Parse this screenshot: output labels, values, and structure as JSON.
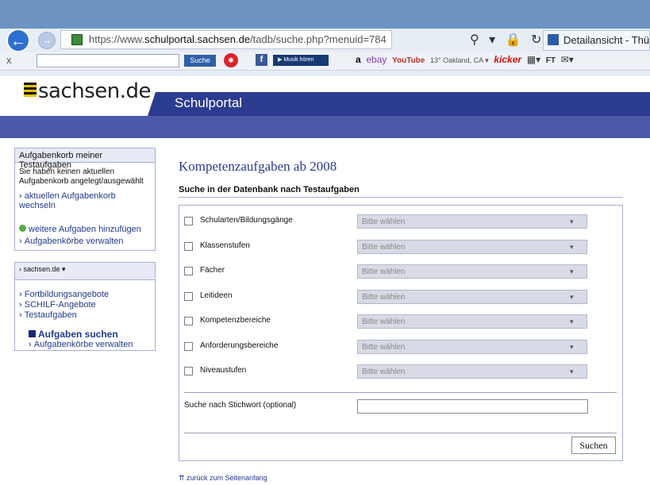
{
  "browser": {
    "url_prefix": "https://www.",
    "url_domain": "schulportal.sachsen.de",
    "url_path": "/tadb/suche.php?menuid=784",
    "tab_title": "Detailansicht - Thür",
    "nav_icons": "⚲ ▾ 🔒 ↻",
    "back_icon": "←",
    "forward_icon": "→",
    "toolbar_close": "x",
    "toolbar_search_label": "Suche",
    "toolbar_music_label": "▶ Musik hören",
    "toolbar_amazon": "a",
    "toolbar_ebay": "ebay",
    "toolbar_youtube": "YouTube",
    "toolbar_weather": "13° Oakland, CA ▾",
    "toolbar_kicker": "kicker",
    "toolbar_ft": "FT"
  },
  "site": {
    "logo_text": "sachsen.de",
    "portal_title": "Schulportal"
  },
  "sidebar": {
    "box1": {
      "header": "Aufgabenkorb meiner Testaufgaben",
      "text": "Sie haben keinen aktuellen Aufgabenkorb angelegt/ausgewählt",
      "link_switch": "aktuellen Aufgabenkorb wechseln",
      "link_add": "weitere Aufgaben hinzufügen",
      "link_manage": "Aufgabenkörbe verwalten"
    },
    "box2": {
      "header": "sachsen.de ▾",
      "items": [
        "Fortbildungsangebote",
        "SCHILF-Angebote",
        "Testaufgaben"
      ],
      "active_item": "Aufgaben suchen",
      "sub_item": "Aufgabenkörbe verwalten"
    }
  },
  "main": {
    "title": "Kompetenzaufgaben ab 2008",
    "subtitle": "Suche in der Datenbank nach Testaufgaben",
    "rows": [
      {
        "label": "Schularten/Bildungsgänge",
        "select": "Bitte wählen"
      },
      {
        "label": "Klassenstufen",
        "select": "Bitte wählen"
      },
      {
        "label": "Fächer",
        "select": "Bitte wählen"
      },
      {
        "label": "Leitideen",
        "select": "Bitte wählen"
      },
      {
        "label": "Kompetenzbereiche",
        "select": "Bitte wählen"
      },
      {
        "label": "Anforderungsbereiche",
        "select": "Bitte wählen"
      },
      {
        "label": "Niveaustufen",
        "select": "Bitte wählen"
      }
    ],
    "keyword_label": "Suche nach Stichwort (optional)",
    "keyword_value": "",
    "search_button": "Suchen",
    "back_to_top": "⇈ zurück zum Seitenanfang"
  },
  "colors": {
    "brand_blue": "#2b3b8f",
    "band_blue": "#4a5aa8",
    "link": "#223a8c"
  }
}
